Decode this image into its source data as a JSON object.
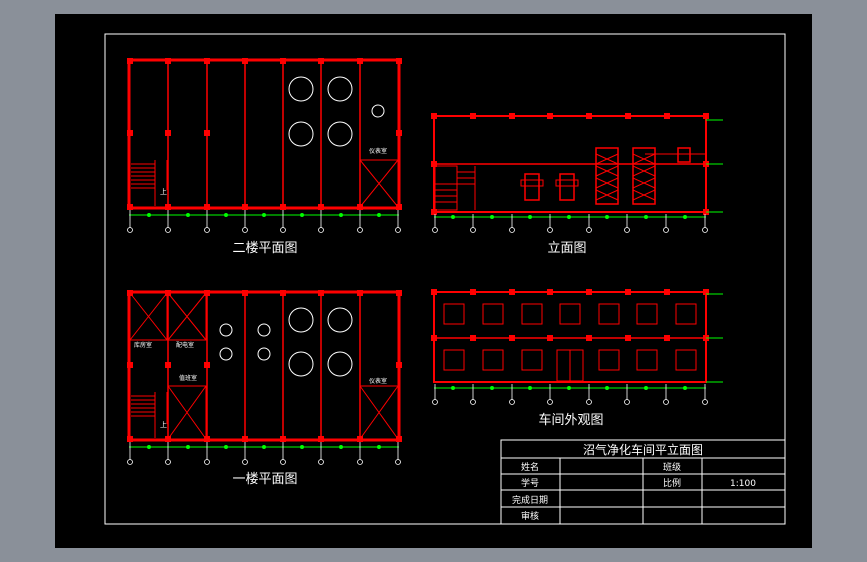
{
  "drawings": {
    "floor2_title": "二楼平面图",
    "elevation_title": "立面图",
    "floor1_title": "一楼平面图",
    "exterior_title": "车间外观图"
  },
  "room_labels": {
    "floor2_control": "仪表室",
    "floor1_control": "仪表室",
    "floor1_a": "库房室",
    "floor1_b": "配电室",
    "floor1_c": "值班室",
    "stair_up_2": "上",
    "stair_up_1": "上"
  },
  "title_block": {
    "title": "沼气净化车间平立面图",
    "name_label": "姓名",
    "class_label": "班级",
    "id_label": "学号",
    "scale_label": "比例",
    "scale_value": "1:100",
    "date_label": "完成日期",
    "review_label": "审核"
  },
  "colors": {
    "sheet": "#000000",
    "wall": "#ff0000",
    "dim": "#00ff00",
    "line": "#ffffff",
    "outer": "#8a9099"
  }
}
